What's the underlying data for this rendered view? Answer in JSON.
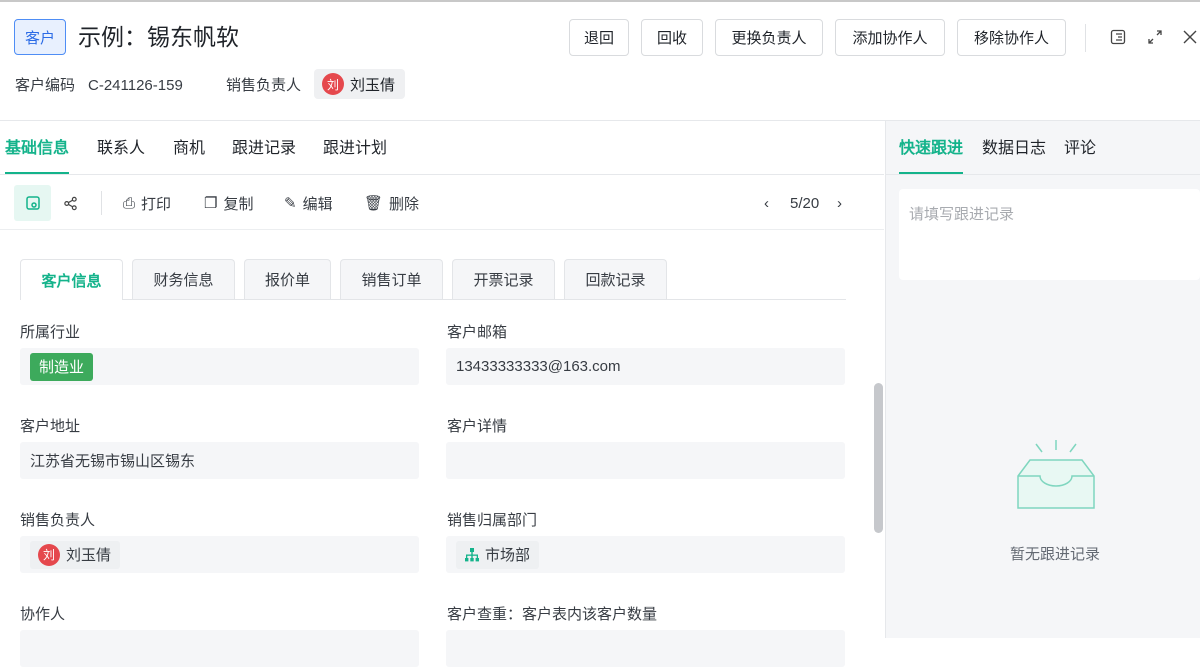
{
  "header": {
    "badge": "客户",
    "title": "示例：锡东帆软",
    "buttons": [
      "退回",
      "回收",
      "更换负责人",
      "添加协作人",
      "移除协作人"
    ],
    "code_label": "客户编码",
    "code_value": "C-241126-159",
    "owner_label": "销售负责人",
    "owner_avatar": "刘",
    "owner_name": "刘玉倩"
  },
  "tabs": [
    "基础信息",
    "联系人",
    "商机",
    "跟进记录",
    "跟进计划"
  ],
  "toolbar": {
    "print": "打印",
    "copy": "复制",
    "edit": "编辑",
    "delete": "删除",
    "pager": "5/20"
  },
  "subtabs": [
    "客户信息",
    "财务信息",
    "报价单",
    "销售订单",
    "开票记录",
    "回款记录"
  ],
  "fields": {
    "industry": {
      "label": "所属行业",
      "value": "制造业"
    },
    "email": {
      "label": "客户邮箱",
      "value": "13433333333@163.com"
    },
    "address": {
      "label": "客户地址",
      "value": "江苏省无锡市锡山区锡东"
    },
    "detail": {
      "label": "客户详情",
      "value": ""
    },
    "owner": {
      "label": "销售负责人",
      "avatar": "刘",
      "value": "刘玉倩"
    },
    "dept": {
      "label": "销售归属部门",
      "value": "市场部"
    },
    "collab": {
      "label": "协作人"
    },
    "dup": {
      "label": "客户查重：客户表内该客户数量"
    }
  },
  "side": {
    "tabs": [
      "快速跟进",
      "数据日志",
      "评论"
    ],
    "placeholder": "请填写跟进记录",
    "empty": "暂无跟进记录"
  },
  "colors": {
    "accent": "#14b38b",
    "badge": "#2b6be6",
    "industry": "#3daa5c",
    "avatar": "#e5484d"
  }
}
